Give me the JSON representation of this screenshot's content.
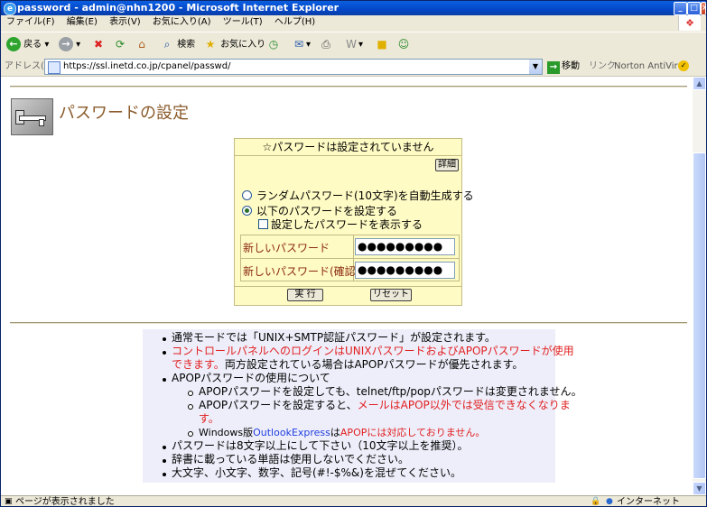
{
  "window": {
    "title": "password - admin@nhn1200 - Microsoft Internet Explorer"
  },
  "menu": [
    "ファイル(F)",
    "編集(E)",
    "表示(V)",
    "お気に入り(A)",
    "ツール(T)",
    "ヘルプ(H)"
  ],
  "toolbar": {
    "back": "戻る",
    "search": "検索",
    "favorites": "お気に入り"
  },
  "address": {
    "label": "アドレス(D)",
    "url": "https://ssl.inetd.co.jp/cpanel/passwd/",
    "go": "移動",
    "links": "リンク",
    "norton": "Norton AntiVirus"
  },
  "page": {
    "title": "パスワードの設定",
    "form": {
      "header": "☆パスワードは設定されていません",
      "detail_button": "詳細",
      "radio_random": "ランダムパスワード(10文字)を自動生成する",
      "radio_manual": "以下のパスワードを設定する",
      "show_password": "設定したパスワードを表示する",
      "new_password_label": "新しいパスワード",
      "new_password_value": "●●●●●●●●●",
      "confirm_password_label": "新しいパスワード(確認)",
      "confirm_password_value": "●●●●●●●●●",
      "submit": "実 行",
      "reset": "リセット"
    },
    "notes": {
      "n1": "通常モードでは「UNIX+SMTP認証パスワード」が設定されます。",
      "n2_red_a": "コントロールパネルへのログインはUNIXパスワードおよびAPOPパスワードが使用",
      "n2_red_b": "できます。",
      "n2_rest": "両方設定されている場合はAPOPパスワードが優先されます。",
      "n3": "APOPパスワードの使用について",
      "s1": "APOPパスワードを設定しても、telnet/ftp/popパスワードは変更されません。",
      "s2_a": "APOPパスワードを設定すると、",
      "s2_red_a": "メールはAPOP以外では受信できなくなりま",
      "s2_red_b": "す。",
      "s3_a": "Windows版",
      "s3_blue": "OutlookExpress",
      "s3_b": "は",
      "s3_red": "APOPには対応しておりません。",
      "n4": "パスワードは8文字以上にして下さい（10文字以上を推奨）。",
      "n5": "辞書に載っている単語は使用しないでください。",
      "n6": "大文字、小文字、数字、記号(#!-$%&)を混ぜてください。"
    }
  },
  "status": {
    "text": "ページが表示されました",
    "zone": "インターネット"
  }
}
